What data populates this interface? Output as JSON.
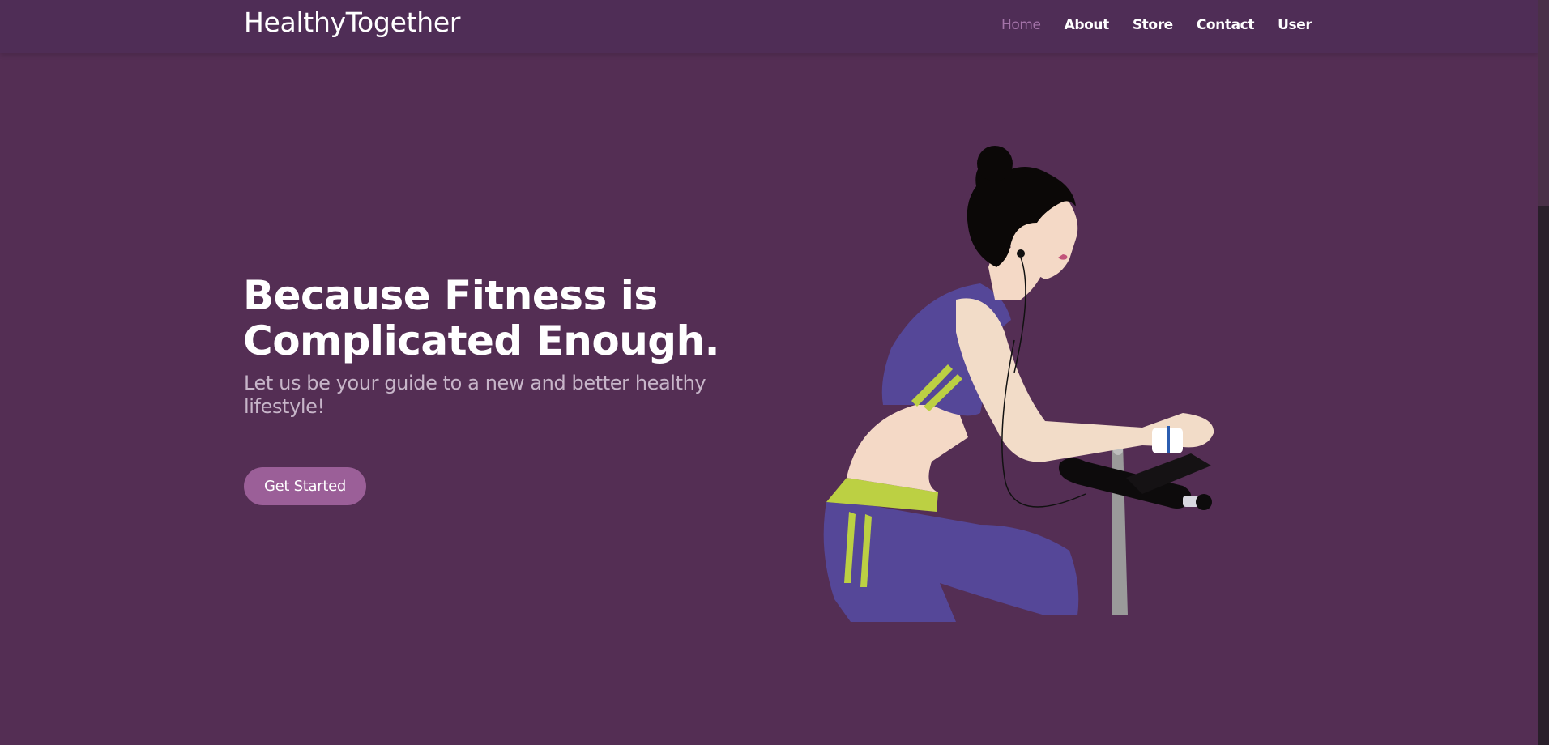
{
  "nav": {
    "brand": "HealthyTogether",
    "links": [
      {
        "label": "Home",
        "active": true
      },
      {
        "label": "About",
        "active": false
      },
      {
        "label": "Store",
        "active": false
      },
      {
        "label": "Contact",
        "active": false
      },
      {
        "label": "User",
        "active": false
      }
    ]
  },
  "hero": {
    "title": "Because Fitness is Complicated Enough.",
    "subtitle": "Let us be your guide to a new and better healthy lifestyle!",
    "cta_label": "Get Started"
  },
  "colors": {
    "background": "#542e54",
    "navbar": "#4f2d56",
    "accent": "#9b5f98",
    "active_link": "#a373a8",
    "subtitle": "#c7b5c9"
  },
  "illustration": {
    "icon": "woman-on-exercise-bike-illustration"
  }
}
